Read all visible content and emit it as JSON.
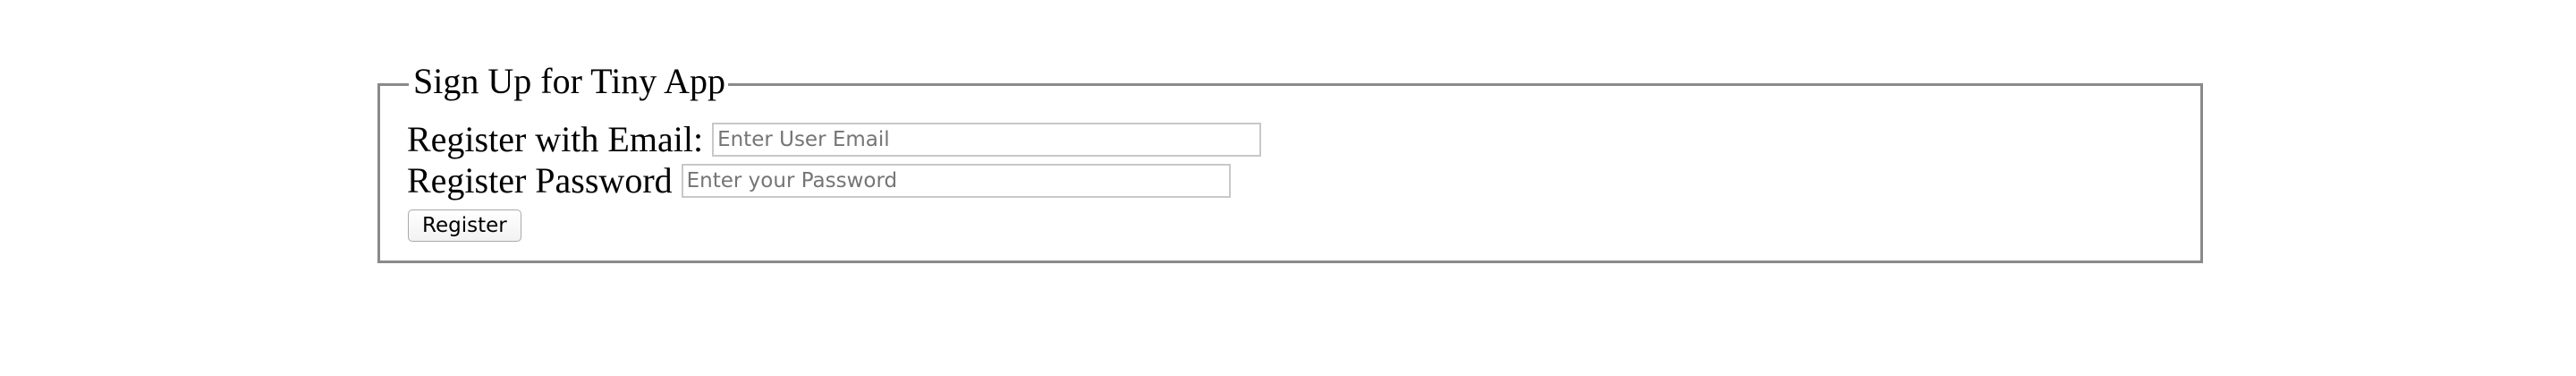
{
  "form": {
    "legend": "Sign Up for Tiny App",
    "email_label": "Register with Email:",
    "email_placeholder": "Enter User Email",
    "password_label": "Register Password",
    "password_placeholder": "Enter your Password",
    "submit_label": "Register"
  }
}
